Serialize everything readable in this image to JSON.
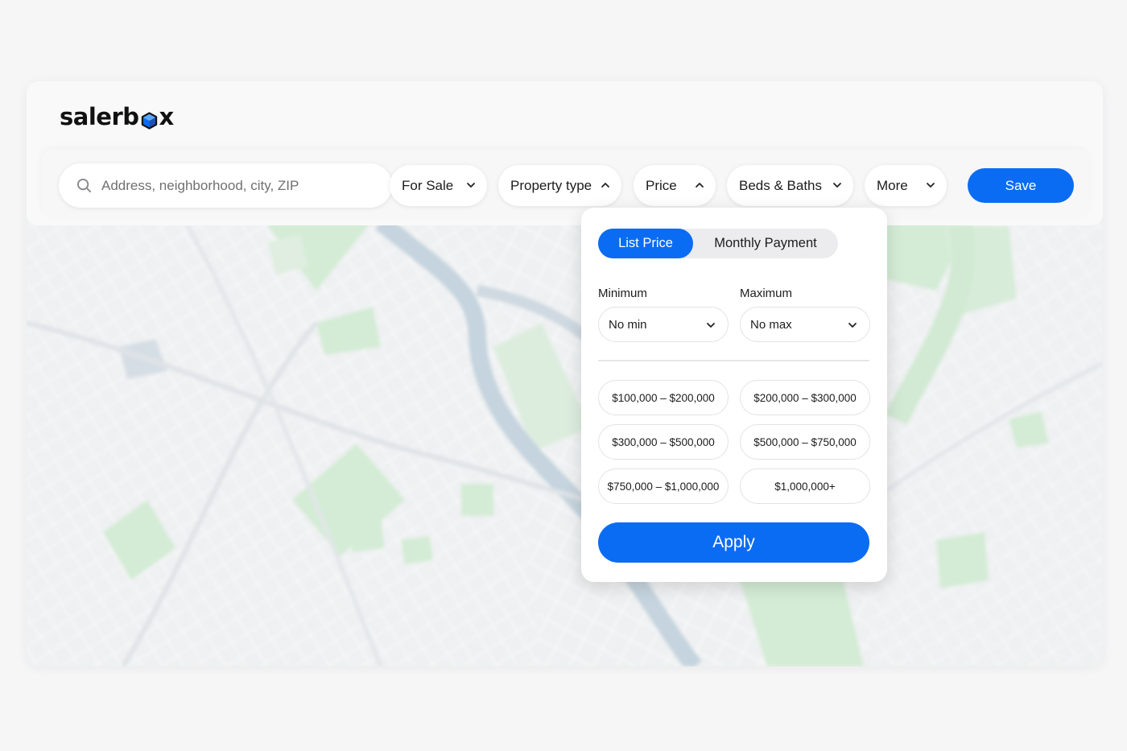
{
  "brand": {
    "logo_text_before": "salerb",
    "logo_text_after": "x",
    "logo_icon": "cube-icon",
    "accent": "#0a6cf2"
  },
  "search": {
    "placeholder": "Address, neighborhood, city, ZIP",
    "icon": "search-icon"
  },
  "filters": [
    {
      "label": "For Sale",
      "icon": "chevron-down-icon"
    },
    {
      "label": "Property type",
      "icon": "chevron-up-icon"
    },
    {
      "label": "Price",
      "icon": "chevron-up-icon"
    },
    {
      "label": "Beds & Baths",
      "icon": "chevron-down-icon"
    },
    {
      "label": "More",
      "icon": "chevron-down-icon"
    }
  ],
  "save_label": "Save",
  "price_panel": {
    "tabs": [
      {
        "label": "List Price",
        "selected": true
      },
      {
        "label": "Monthly Payment",
        "selected": false
      }
    ],
    "minimum": {
      "label": "Minimum",
      "value": "No min"
    },
    "maximum": {
      "label": "Maximum",
      "value": "No max"
    },
    "ranges": [
      "$100,000 – $200,000",
      "$200,000 – $300,000",
      "$300,000 – $500,000",
      "$500,000 – $750,000",
      "$750,000 – $1,000,000",
      "$1,000,000+"
    ],
    "apply_label": "Apply"
  },
  "colors": {
    "map_park": "#d4ecd6",
    "map_water": "#c5d4de",
    "map_base": "#eef0f1"
  }
}
